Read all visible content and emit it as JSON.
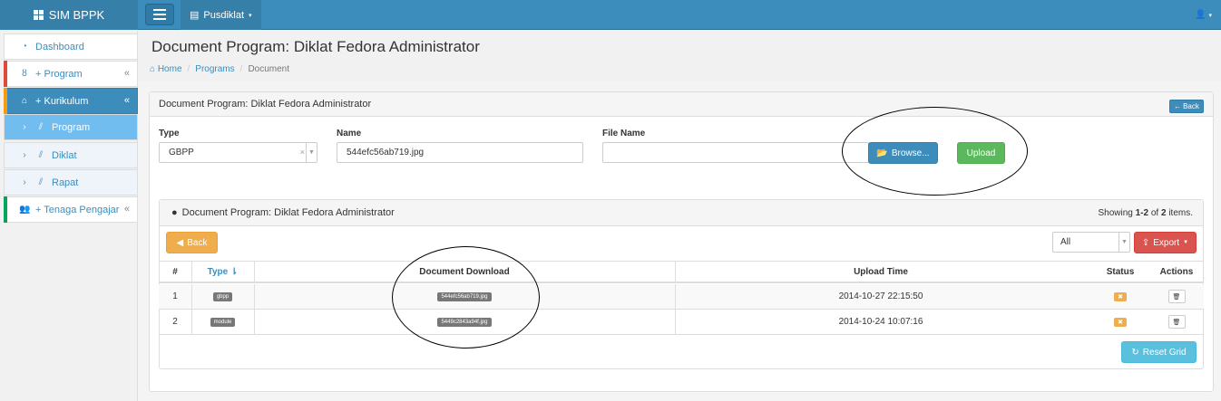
{
  "navbar": {
    "brand": "SIM BPPK",
    "pusdiklat_label": "Pusdiklat"
  },
  "sidebar": {
    "items": [
      {
        "label": "Dashboard"
      },
      {
        "label": "+ Program"
      },
      {
        "label": "+ Kurikulum"
      },
      {
        "label": "Program"
      },
      {
        "label": "Diklat"
      },
      {
        "label": "Rapat"
      },
      {
        "label": "+ Tenaga Pengajar"
      }
    ]
  },
  "page": {
    "title": "Document Program: Diklat Fedora Administrator",
    "breadcrumb": [
      "Home",
      "Programs",
      "Document"
    ]
  },
  "form_panel": {
    "heading": "Document Program: Diklat Fedora Administrator",
    "back_label": "Back",
    "type_label": "Type",
    "type_value": "GBPP",
    "name_label": "Name",
    "name_value": "544efc56ab719.jpg",
    "file_label": "File Name",
    "file_value": "",
    "browse_label": "Browse...",
    "upload_label": "Upload"
  },
  "grid": {
    "heading": "Document Program: Diklat Fedora Administrator",
    "summary_prefix": "Showing ",
    "summary_range": "1-2",
    "summary_mid": " of ",
    "summary_total": "2",
    "summary_suffix": " items.",
    "back_label": "Back",
    "filter_value": "All",
    "export_label": "Export",
    "reset_label": "Reset Grid",
    "columns": [
      "#",
      "Type",
      "Document Download",
      "Upload Time",
      "Status",
      "Actions"
    ],
    "rows": [
      {
        "num": "1",
        "type": "gbpp",
        "file": "544efc56ab719.jpg",
        "time": "2014-10-27 22:15:50",
        "status": "✖"
      },
      {
        "num": "2",
        "type": "module",
        "file": "5449c2843a94f.jpg",
        "time": "2014-10-24 10:07:16",
        "status": "✖"
      }
    ]
  },
  "colors": {
    "primary": "#3c8dbc",
    "success": "#5cb85c",
    "warning": "#f0ad4e",
    "danger": "#d9534f",
    "info": "#5bc0de"
  }
}
